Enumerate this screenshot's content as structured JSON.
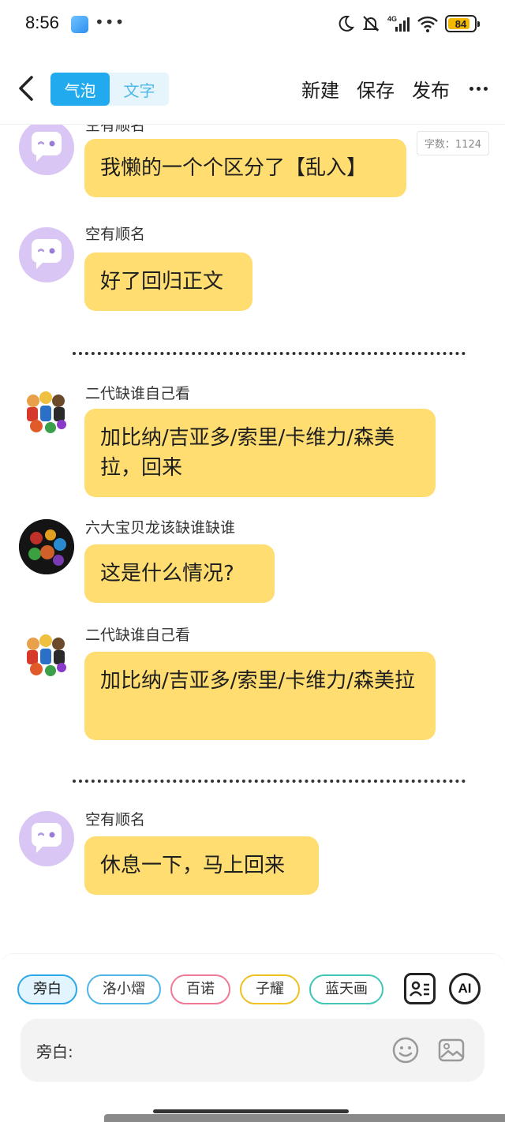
{
  "status_bar": {
    "time": "8:56",
    "dots": "•••",
    "network": "4G",
    "battery": "84",
    "battery_level": 0.84
  },
  "header": {
    "tabs": [
      {
        "label": "气泡",
        "active": true
      },
      {
        "label": "文字",
        "active": false
      }
    ],
    "actions": {
      "new": "新建",
      "save": "保存",
      "publish": "发布"
    }
  },
  "word_count": "字数：1124",
  "messages": [
    {
      "sender": "空有顺名",
      "text": "我懒的一个个区分了【乱入】",
      "avatar": "ghost-avatar"
    },
    {
      "sender": "空有顺名",
      "text": "好了回归正文",
      "avatar": "ghost-avatar"
    },
    {
      "sender": "二代缺谁自己看",
      "text": "加比纳/吉亚多/索里/卡维力/森美拉，回来",
      "avatar": "group-avatar"
    },
    {
      "sender": "六大宝贝龙该缺谁缺谁",
      "text": "这是什么情况?",
      "avatar": "dark-group-avatar"
    },
    {
      "sender": "二代缺谁自己看",
      "text": "加比纳/吉亚多/索里/卡维力/森美拉",
      "avatar": "group-avatar"
    },
    {
      "sender": "空有顺名",
      "text": "休息一下，马上回来",
      "avatar": "ghost-avatar"
    }
  ],
  "roles": [
    "旁白",
    "洛小熠",
    "百诺",
    "子耀",
    "蓝天画"
  ],
  "ai_label": "AI",
  "input": {
    "label": "旁白:"
  },
  "colors": {
    "bubble": "#ffdd70",
    "accent": "#22aaee",
    "ghost_avatar": "#d9c6f5"
  }
}
